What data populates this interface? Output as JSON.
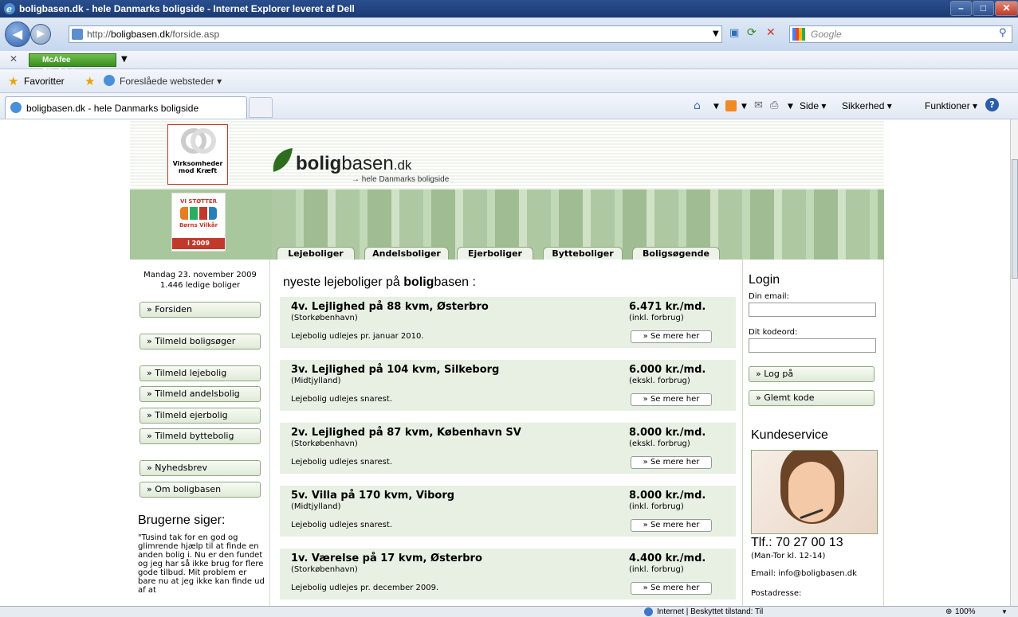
{
  "window": {
    "title": "boligbasen.dk - hele Danmarks boligside - Internet Explorer leveret af Dell"
  },
  "address": {
    "url_prefix": "http://",
    "url_domain": "boligbasen.dk",
    "url_path": "/forside.asp",
    "search_placeholder": "Google"
  },
  "mcafee": {
    "label": "McAfee SiteAdvisor"
  },
  "favorites": {
    "label": "Favoritter",
    "suggested": "Foreslåede websteder ▾"
  },
  "tab": {
    "label": "boligbasen.dk - hele Danmarks boligside"
  },
  "commandbar": {
    "side": "Side ▾",
    "security": "Sikkerhed ▾",
    "tools": "Funktioner ▾"
  },
  "status": {
    "text": "Internet | Beskyttet tilstand: Til",
    "zoom": "100%"
  },
  "site": {
    "logo_bold": "bolig",
    "logo_rest": "basen",
    "logo_tld": ".dk",
    "tagline": "→ hele Danmarks boligside",
    "sponsor1": "Virksomheder mod Kræft",
    "sponsor2_top": "VI STØTTER",
    "sponsor2_mid": "Børns Vilkår",
    "sponsor2_year": "i 2009",
    "tabs": [
      "Lejeboliger",
      "Andelsboliger",
      "Ejerboliger",
      "Bytteboliger",
      "Boligsøgende"
    ],
    "date": "Mandag 23. november 2009",
    "count": "1.446 ledige boliger",
    "nav": [
      "» Forsiden",
      "» Tilmeld boligsøger",
      "» Tilmeld lejebolig",
      "» Tilmeld andelsbolig",
      "» Tilmeld ejerbolig",
      "» Tilmeld byttebolig",
      "» Nyhedsbrev",
      "» Om boligbasen"
    ],
    "users_heading": "Brugerne siger:",
    "quote": "\"Tusind tak for en god og glimrende hjælp til at finde en anden bolig i. Nu er den fundet og jeg har så ikke brug for flere gode tilbud. Mit problem er bare nu at jeg ikke kan finde ud af at",
    "heading_pre": "nyeste lejeboliger på ",
    "heading_bold": "bolig",
    "heading_post": "basen :",
    "listings": [
      {
        "title": "4v. Lejlighed på 88 kvm, Østerbro",
        "region": "(Storkøbenhavn)",
        "price": "6.471 kr./md.",
        "note": "(inkl. forbrug)",
        "avail": "Lejebolig udlejes pr. januar 2010.",
        "more": "» Se mere her"
      },
      {
        "title": "3v. Lejlighed på 104 kvm, Silkeborg",
        "region": "(Midtjylland)",
        "price": "6.000 kr./md.",
        "note": "(ekskl. forbrug)",
        "avail": "Lejebolig udlejes snarest.",
        "more": "» Se mere her"
      },
      {
        "title": "2v. Lejlighed på 87 kvm, København SV",
        "region": "(Storkøbenhavn)",
        "price": "8.000 kr./md.",
        "note": "(ekskl. forbrug)",
        "avail": "Lejebolig udlejes snarest.",
        "more": "» Se mere her"
      },
      {
        "title": "5v. Villa på 170 kvm, Viborg",
        "region": "(Midtjylland)",
        "price": "8.000 kr./md.",
        "note": "(inkl. forbrug)",
        "avail": "Lejebolig udlejes snarest.",
        "more": "» Se mere her"
      },
      {
        "title": "1v. Værelse på 17 kvm, Østerbro",
        "region": "(Storkøbenhavn)",
        "price": "4.400 kr./md.",
        "note": "(inkl. forbrug)",
        "avail": "Lejebolig udlejes pr. december 2009.",
        "more": "» Se mere her"
      }
    ],
    "login": {
      "heading": "Login",
      "email_label": "Din email:",
      "password_label": "Dit kodeord:",
      "login_btn": "» Log på",
      "forgot_btn": "» Glemt kode"
    },
    "service": {
      "heading": "Kundeservice",
      "phone": "Tlf.: 70 27 00 13",
      "hours": "(Man-Tor kl. 12-14)",
      "email": "Email: info@boligbasen.dk",
      "post": "Postadresse:"
    }
  }
}
